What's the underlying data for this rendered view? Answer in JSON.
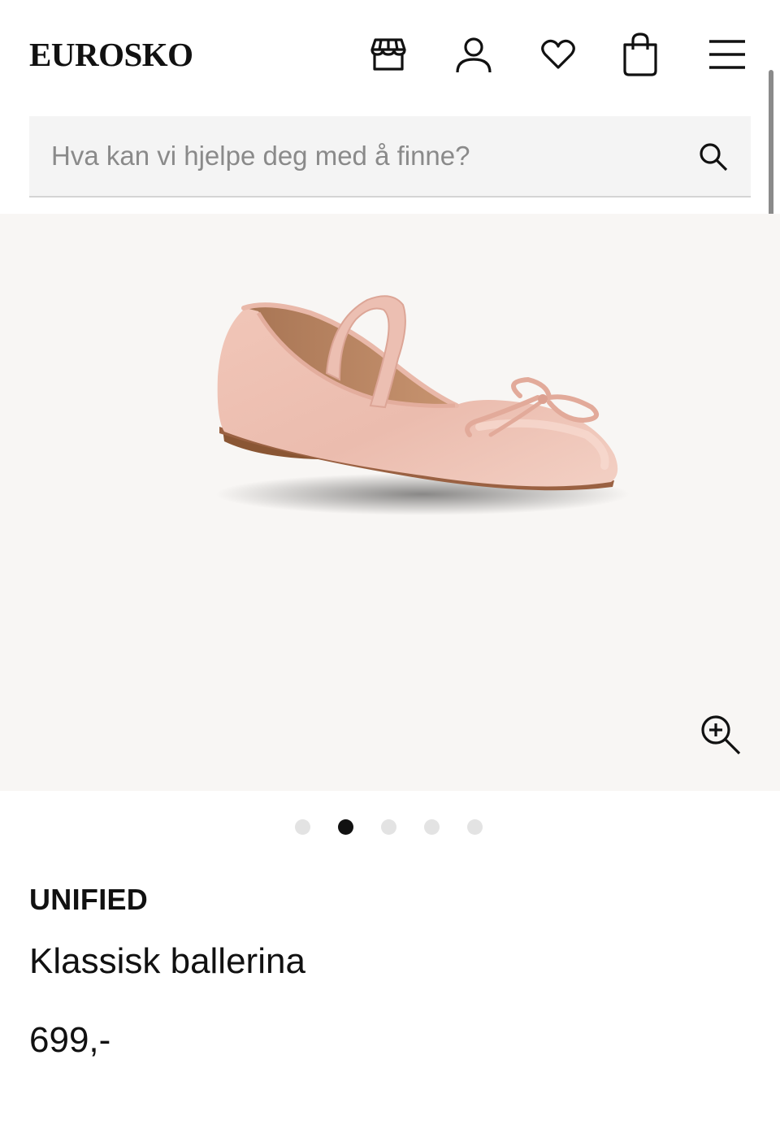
{
  "header": {
    "logo": "EUROSKO",
    "icons": [
      "store-icon",
      "user-icon",
      "heart-icon",
      "bag-icon",
      "menu-icon"
    ]
  },
  "search": {
    "placeholder": "Hva kan vi hjelpe deg med å finne?",
    "value": "",
    "icon": "search-icon"
  },
  "gallery": {
    "image_alt": "pink ballet flat with strap and bow",
    "slide_count": 5,
    "active_index": 1,
    "zoom_icon": "zoom-in-icon"
  },
  "product": {
    "brand": "UNIFIED",
    "name": "Klassisk ballerina",
    "price": "699,-"
  },
  "colors": {
    "text": "#111111",
    "search_bg": "#f4f4f4",
    "gallery_bg": "#f8f6f4",
    "dot_active": "#111111",
    "dot_inactive": "#e3e3e3",
    "shoe_pink": "#ebbcae"
  }
}
